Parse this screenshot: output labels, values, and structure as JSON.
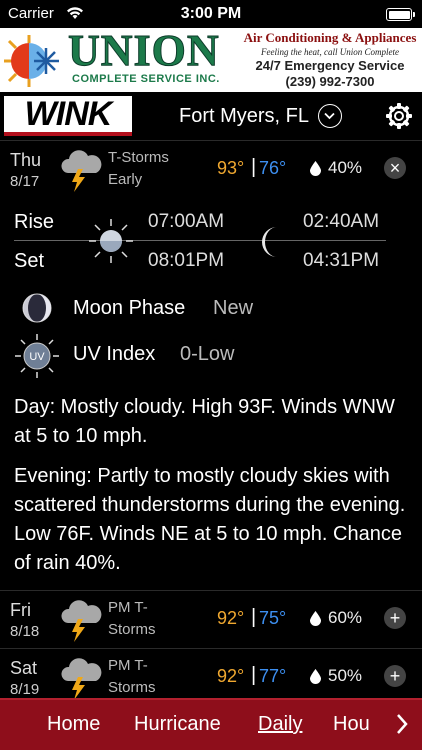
{
  "status_bar": {
    "carrier": "Carrier",
    "time": "3:00 PM"
  },
  "ad": {
    "brand": "UNION",
    "brand_sub": "COMPLETE SERVICE INC.",
    "line1": "Air Conditioning & Appliances",
    "line2": "Feeling the heat, call Union Complete",
    "line3": "24/7 Emergency Service",
    "line4": "(239) 992-7300"
  },
  "header": {
    "logo": "WINK",
    "location": "Fort Myers, FL"
  },
  "forecast": [
    {
      "dow": "Thu",
      "date": "8/17",
      "cond_line1": "T-Storms",
      "cond_line2": "Early",
      "hi": "93°",
      "lo": "76°",
      "precip": "40%",
      "toggle": "×"
    },
    {
      "dow": "Fri",
      "date": "8/18",
      "cond_line1": "PM T-",
      "cond_line2": "Storms",
      "hi": "92°",
      "lo": "75°",
      "precip": "60%",
      "toggle": "+"
    },
    {
      "dow": "Sat",
      "date": "8/19",
      "cond_line1": "PM T-",
      "cond_line2": "Storms",
      "hi": "92°",
      "lo": "77°",
      "precip": "50%",
      "toggle": "+"
    }
  ],
  "details": {
    "rise_label": "Rise",
    "set_label": "Set",
    "sunrise": "07:00AM",
    "sunset": "08:01PM",
    "moonrise": "02:40AM",
    "moonset": "04:31PM",
    "moon_phase_label": "Moon Phase",
    "moon_phase_value": "New",
    "uv_label": "UV Index",
    "uv_value": "0-Low",
    "uv_icon_text": "UV",
    "day_text": "Day: Mostly cloudy. High 93F. Winds WNW at 5 to 10 mph.",
    "evening_text": "Evening: Partly to mostly cloudy skies with scattered thunderstorms during the evening. Low 76F. Winds NE at 5 to 10 mph. Chance of rain 40%."
  },
  "nav": {
    "items": [
      "Home",
      "Hurricane",
      "Daily",
      "Hou"
    ],
    "active": "Daily"
  },
  "colors": {
    "high_temp": "#f0a830",
    "low_temp": "#3d8ff0",
    "nav_bg": "#8e0e1b"
  }
}
